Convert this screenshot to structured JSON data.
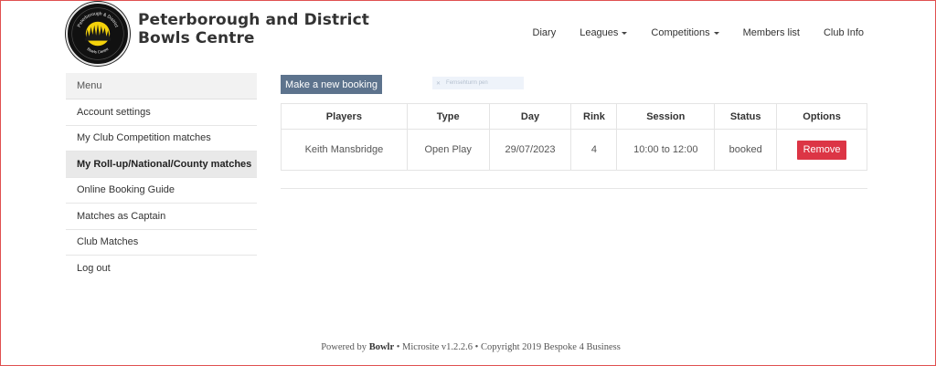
{
  "header": {
    "title_line1": "Peterborough and District",
    "title_line2": "Bowls Centre",
    "logo_icon": "club-crest-icon",
    "logo_text_top": "Peterborough & District",
    "logo_text_bottom": "Bowls Centre"
  },
  "nav": {
    "items": [
      {
        "label": "Diary",
        "dropdown": false
      },
      {
        "label": "Leagues",
        "dropdown": true
      },
      {
        "label": "Competitions",
        "dropdown": true
      },
      {
        "label": "Members list",
        "dropdown": false
      },
      {
        "label": "Club Info",
        "dropdown": false
      }
    ]
  },
  "sidebar": {
    "heading": "Menu",
    "items": [
      {
        "label": "Account settings"
      },
      {
        "label": "My Club Competition matches"
      },
      {
        "label": "My Roll-up/National/County matches"
      },
      {
        "label": "Online Booking Guide"
      },
      {
        "label": "Matches as Captain"
      },
      {
        "label": "Club Matches"
      },
      {
        "label": "Log out"
      }
    ],
    "active_index": 2
  },
  "main": {
    "new_booking_label": "Make a new booking",
    "search_placeholder": "Fernsehturm pen",
    "table": {
      "columns": [
        "Players",
        "Type",
        "Day",
        "Rink",
        "Session",
        "Status",
        "Options"
      ],
      "rows": [
        {
          "players": "Keith Mansbridge",
          "type": "Open Play",
          "day": "29/07/2023",
          "rink": "4",
          "session": "10:00 to 12:00",
          "status": "booked",
          "option_label": "Remove"
        }
      ]
    }
  },
  "footer": {
    "prefix": "Powered by",
    "brand": "Bowlr",
    "rest": "• Microsite v1.2.2.6 • Copyright 2019 Bespoke 4 Business"
  },
  "colors": {
    "primary_button": "#5d738d",
    "danger_button": "#dc3545",
    "frame_border": "#e05050"
  }
}
